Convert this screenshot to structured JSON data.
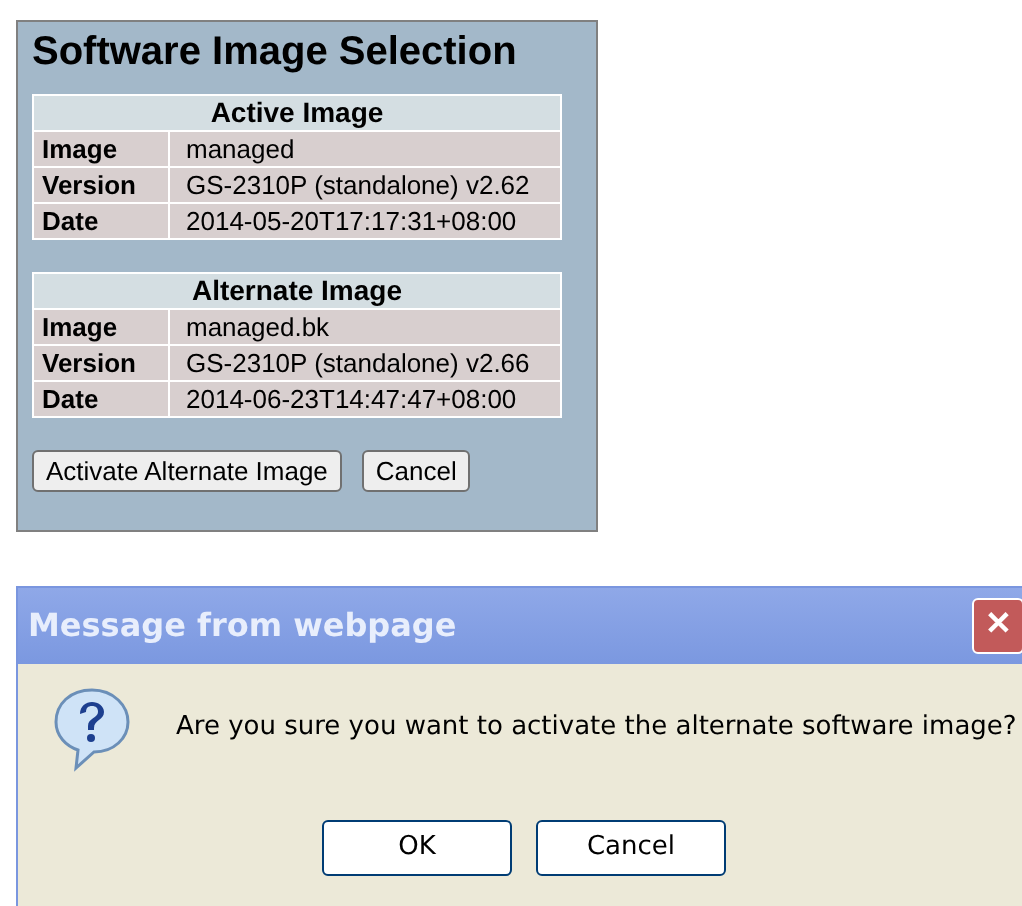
{
  "panel": {
    "title": "Software Image Selection",
    "tables": [
      {
        "heading": "Active Image",
        "rows": [
          {
            "label": "Image",
            "value": "managed"
          },
          {
            "label": "Version",
            "value": "GS-2310P (standalone) v2.62"
          },
          {
            "label": "Date",
            "value": "2014-05-20T17:17:31+08:00"
          }
        ]
      },
      {
        "heading": "Alternate Image",
        "rows": [
          {
            "label": "Image",
            "value": "managed.bk"
          },
          {
            "label": "Version",
            "value": "GS-2310P (standalone) v2.66"
          },
          {
            "label": "Date",
            "value": "2014-06-23T14:47:47+08:00"
          }
        ]
      }
    ],
    "buttons": [
      "Activate Alternate Image",
      "Cancel"
    ]
  },
  "dialog": {
    "title": "Message from webpage",
    "close": "✕",
    "message": "Are you sure you want to activate the alternate software image?",
    "buttons": [
      "OK",
      "Cancel"
    ]
  }
}
